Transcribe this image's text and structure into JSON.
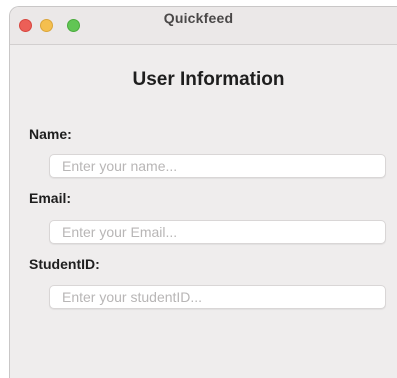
{
  "window": {
    "title": "Quickfeed",
    "controls": [
      "close",
      "minimize",
      "maximize"
    ]
  },
  "form": {
    "heading": "User Information",
    "fields": [
      {
        "label": "Name:",
        "value": "",
        "placeholder": "Enter your name..."
      },
      {
        "label": "Email:",
        "value": "",
        "placeholder": "Enter your Email..."
      },
      {
        "label": "StudentID:",
        "value": "",
        "placeholder": "Enter your studentID..."
      }
    ]
  },
  "colors": {
    "close": "#ec5f57",
    "minimize": "#f4bf4f",
    "maximize": "#61c554",
    "window_background": "#efeded"
  }
}
